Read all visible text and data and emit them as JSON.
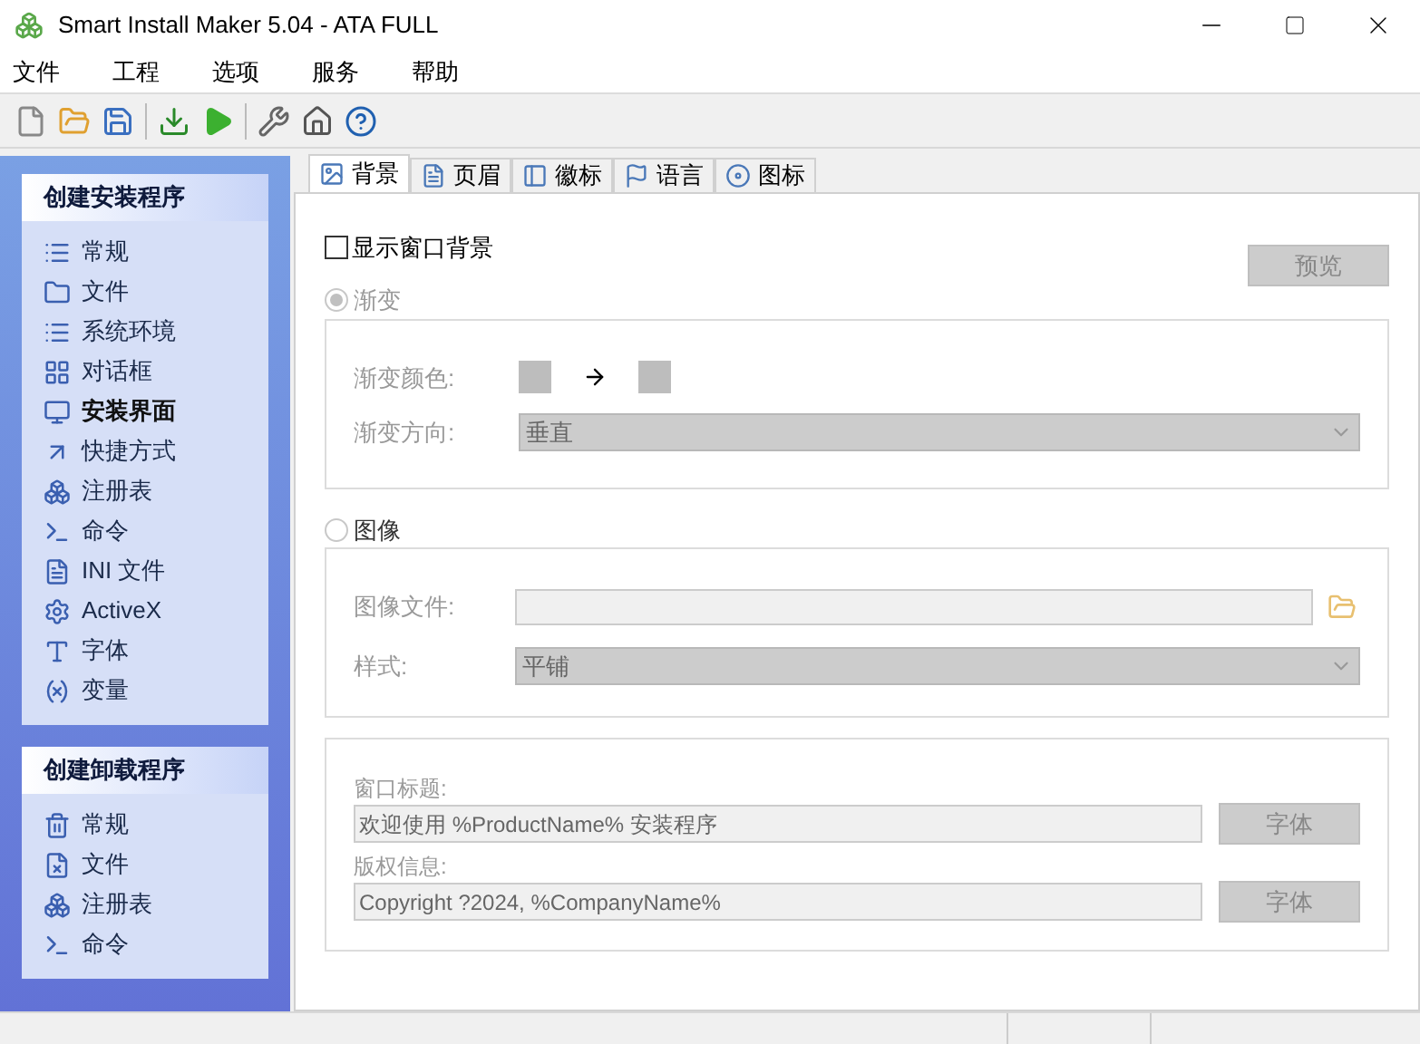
{
  "window": {
    "title": "Smart Install Maker 5.04 - ATA FULL"
  },
  "menu": [
    "文件",
    "工程",
    "选项",
    "服务",
    "帮助"
  ],
  "sidebar": {
    "sections": [
      {
        "title": "创建安装程序",
        "items": [
          {
            "label": "常规",
            "selected": false
          },
          {
            "label": "文件",
            "selected": false
          },
          {
            "label": "系统环境",
            "selected": false
          },
          {
            "label": "对话框",
            "selected": false
          },
          {
            "label": "安装界面",
            "selected": true
          },
          {
            "label": "快捷方式",
            "selected": false
          },
          {
            "label": "注册表",
            "selected": false
          },
          {
            "label": "命令",
            "selected": false
          },
          {
            "label": "INI 文件",
            "selected": false
          },
          {
            "label": "ActiveX",
            "selected": false
          },
          {
            "label": "字体",
            "selected": false
          },
          {
            "label": "变量",
            "selected": false
          }
        ]
      },
      {
        "title": "创建卸载程序",
        "items": [
          {
            "label": "常规",
            "selected": false
          },
          {
            "label": "文件",
            "selected": false
          },
          {
            "label": "注册表",
            "selected": false
          },
          {
            "label": "命令",
            "selected": false
          }
        ]
      }
    ]
  },
  "tabs": [
    {
      "label": "背景",
      "selected": true
    },
    {
      "label": "页眉",
      "selected": false
    },
    {
      "label": "徽标",
      "selected": false
    },
    {
      "label": "语言",
      "selected": false
    },
    {
      "label": "图标",
      "selected": false
    }
  ],
  "show_background": {
    "label": "显示窗口背景",
    "checked": false
  },
  "preview_button": "预览",
  "gradient": {
    "label": "渐变",
    "selected": true,
    "color_label": "渐变颜色:",
    "direction_label": "渐变方向:",
    "direction_value": "垂直"
  },
  "image": {
    "label": "图像",
    "selected": false,
    "file_label": "图像文件:",
    "style_label": "样式:",
    "style_value": "平铺"
  },
  "window_title": {
    "label": "窗口标题:",
    "value": "欢迎使用 %ProductName% 安装程序",
    "font_button": "字体"
  },
  "copyright": {
    "label": "版权信息:",
    "value": "Copyright ?2024, %CompanyName%",
    "font_button": "字体"
  }
}
